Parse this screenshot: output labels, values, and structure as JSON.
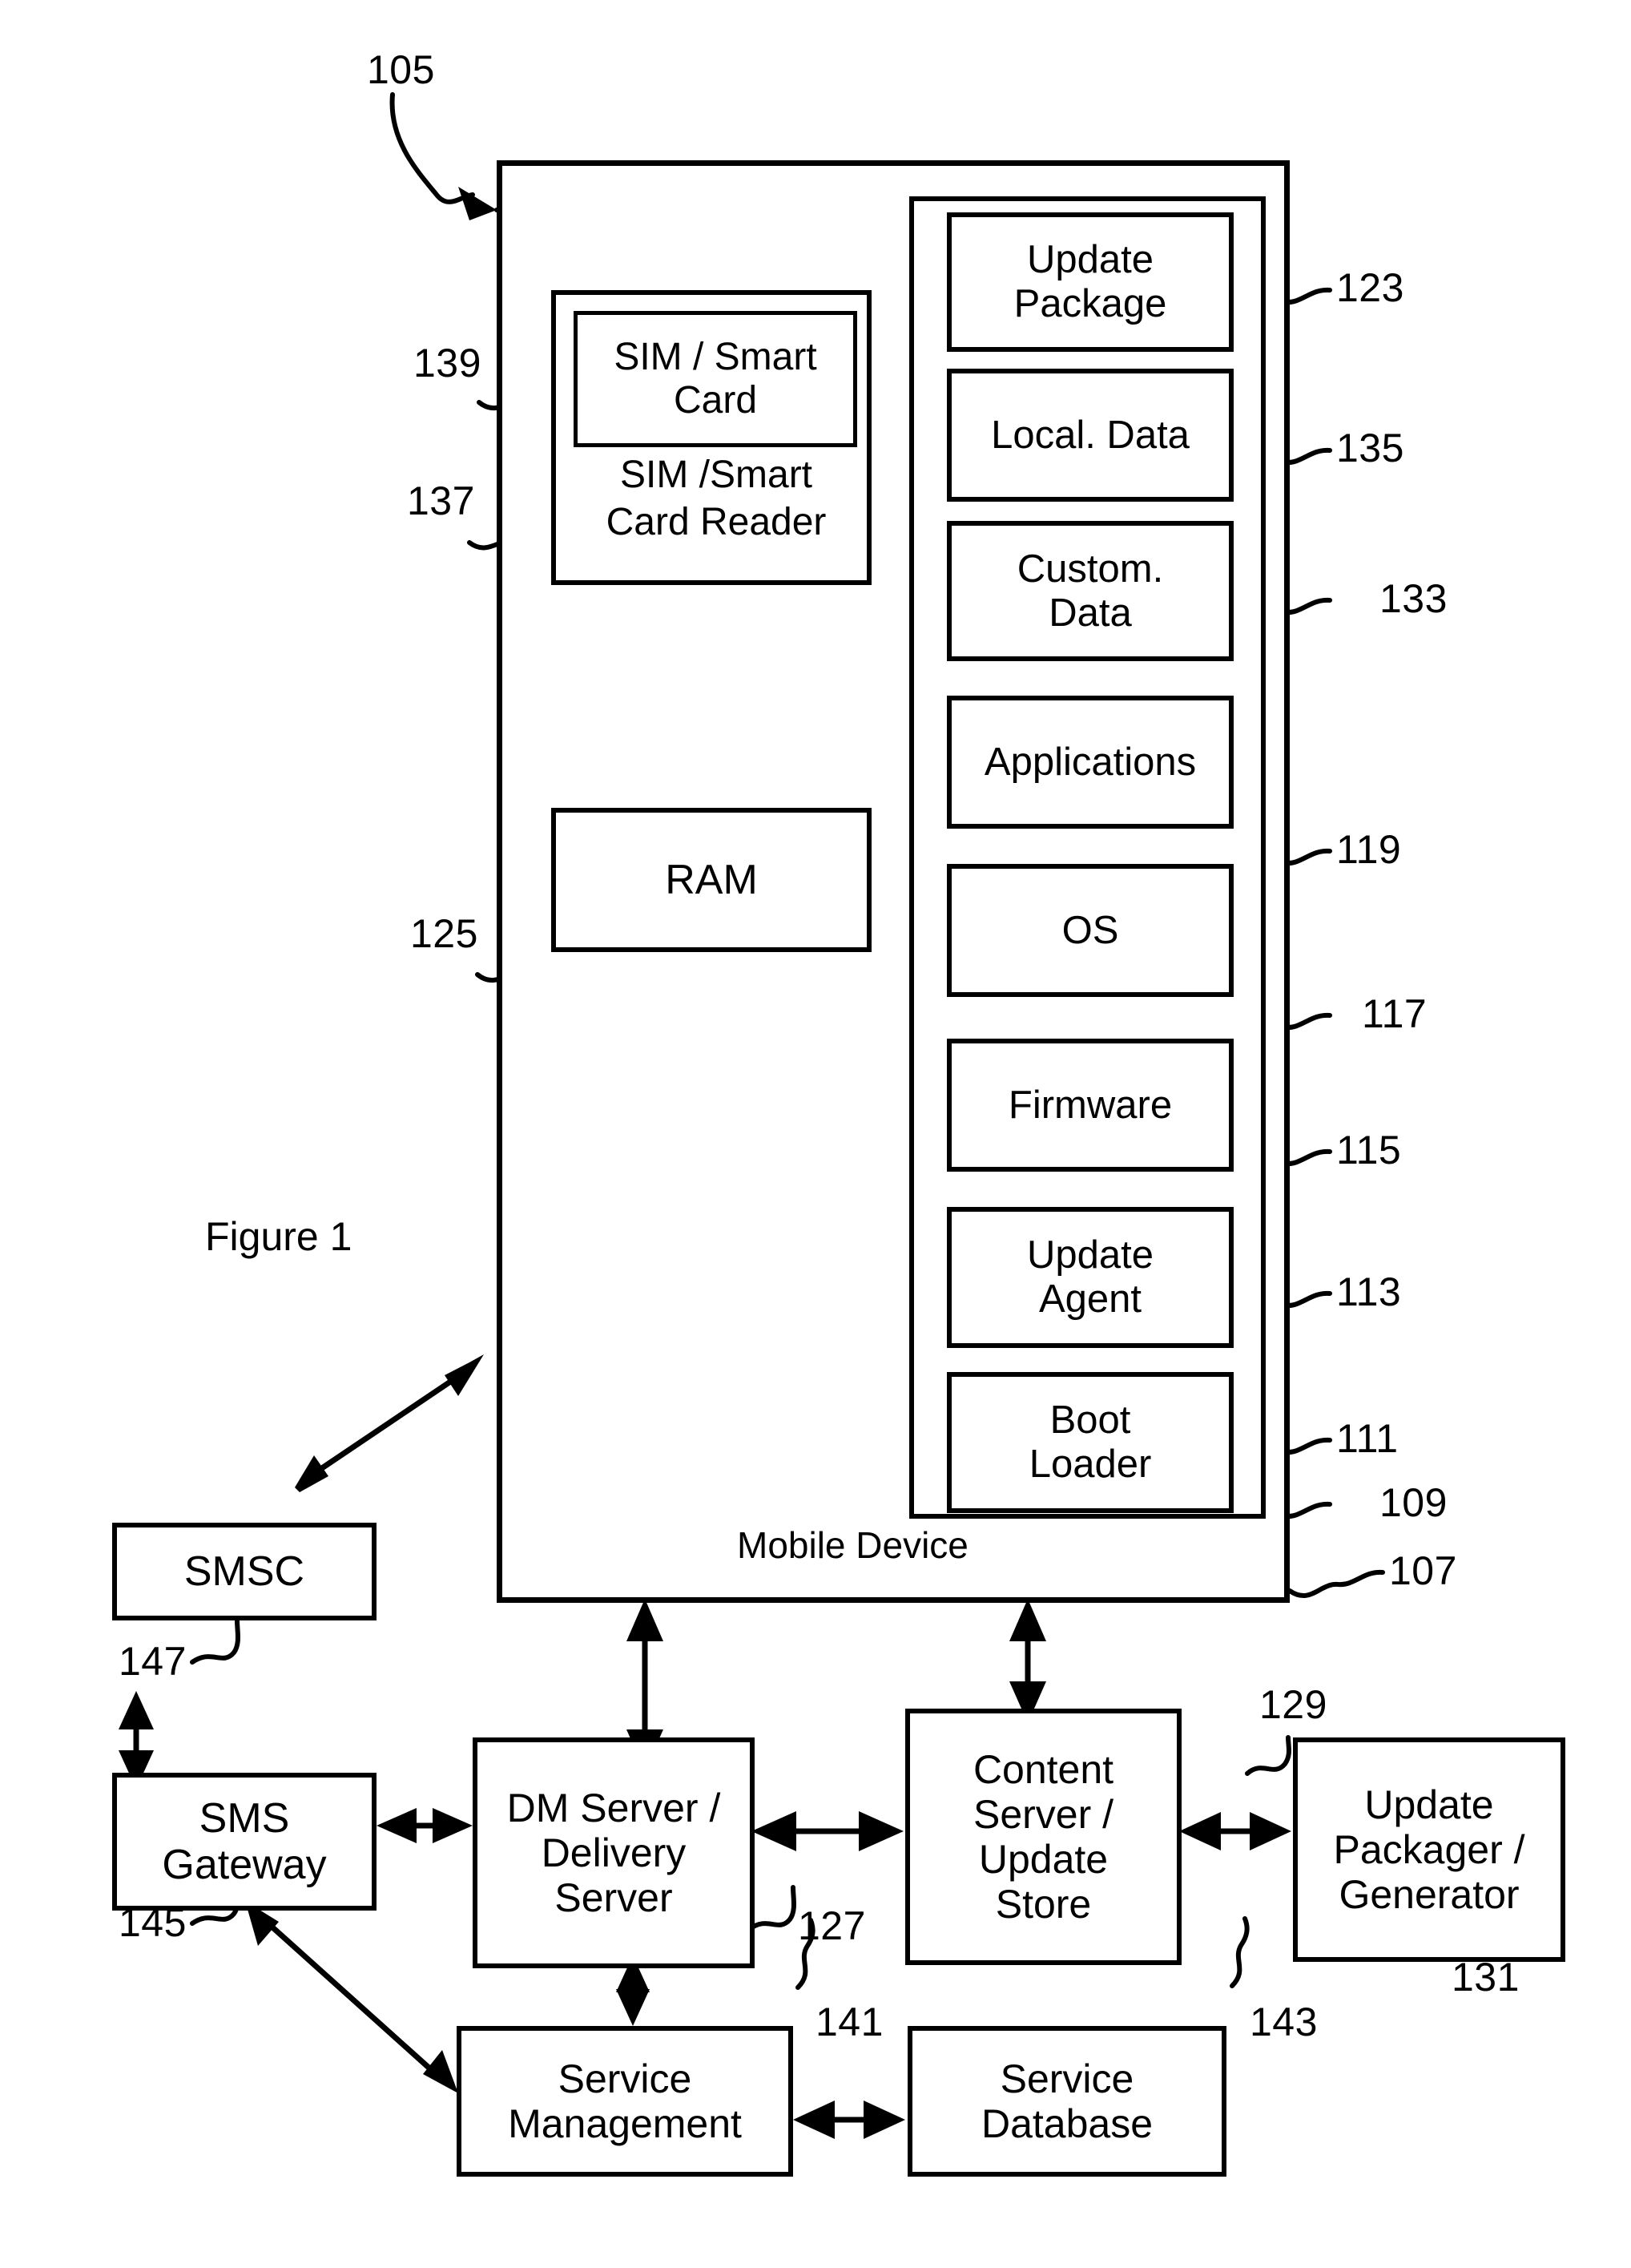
{
  "figure": {
    "caption": "Figure 1",
    "top_ref": "105"
  },
  "device": {
    "name": "Mobile Device",
    "chassis_ref": "107",
    "memory_ref": "109",
    "sim_card": {
      "label": "SIM / Smart\nCard",
      "line1": "SIM / Smart",
      "line2": "Card",
      "ref": "139"
    },
    "sim_reader": {
      "line1": "SIM /Smart",
      "line2": "Card Reader",
      "ref": "137"
    },
    "ram": {
      "label": "RAM",
      "ref": "125"
    },
    "memory_blocks": [
      {
        "line1": "Update",
        "line2": "Package",
        "ref": "123"
      },
      {
        "line1": "Local. Data",
        "line2": "",
        "ref": "135"
      },
      {
        "line1": "Custom.",
        "line2": "Data",
        "ref": "133"
      },
      {
        "line1": "Applications",
        "line2": "",
        "ref": "119"
      },
      {
        "line1": "OS",
        "line2": "",
        "ref": "117"
      },
      {
        "line1": "Firmware",
        "line2": "",
        "ref": "115"
      },
      {
        "line1": "Update",
        "line2": "Agent",
        "ref": "113"
      },
      {
        "line1": "Boot",
        "line2": "Loader",
        "ref": "111"
      }
    ]
  },
  "network": {
    "smsc": {
      "line1": "SMSC",
      "line2": "",
      "line3": "",
      "ref": "147"
    },
    "sms_gateway": {
      "line1": "SMS",
      "line2": "Gateway",
      "line3": "",
      "ref": "145"
    },
    "dm_server": {
      "line1": "DM Server /",
      "line2": "Delivery",
      "line3": "Server",
      "ref": "127"
    },
    "content_server": {
      "line1": "Content",
      "line2": "Server /",
      "line3": "Update",
      "line4": "Store",
      "ref": "129"
    },
    "update_packager": {
      "line1": "Update",
      "line2": "Packager /",
      "line3": "Generator",
      "ref": "131"
    },
    "service_management": {
      "line1": "Service",
      "line2": "Management",
      "line3": "",
      "ref": "141"
    },
    "service_database": {
      "line1": "Service",
      "line2": "Database",
      "line3": "",
      "ref": "143"
    }
  },
  "colors": {
    "ink": "#000000",
    "paper": "#ffffff"
  }
}
